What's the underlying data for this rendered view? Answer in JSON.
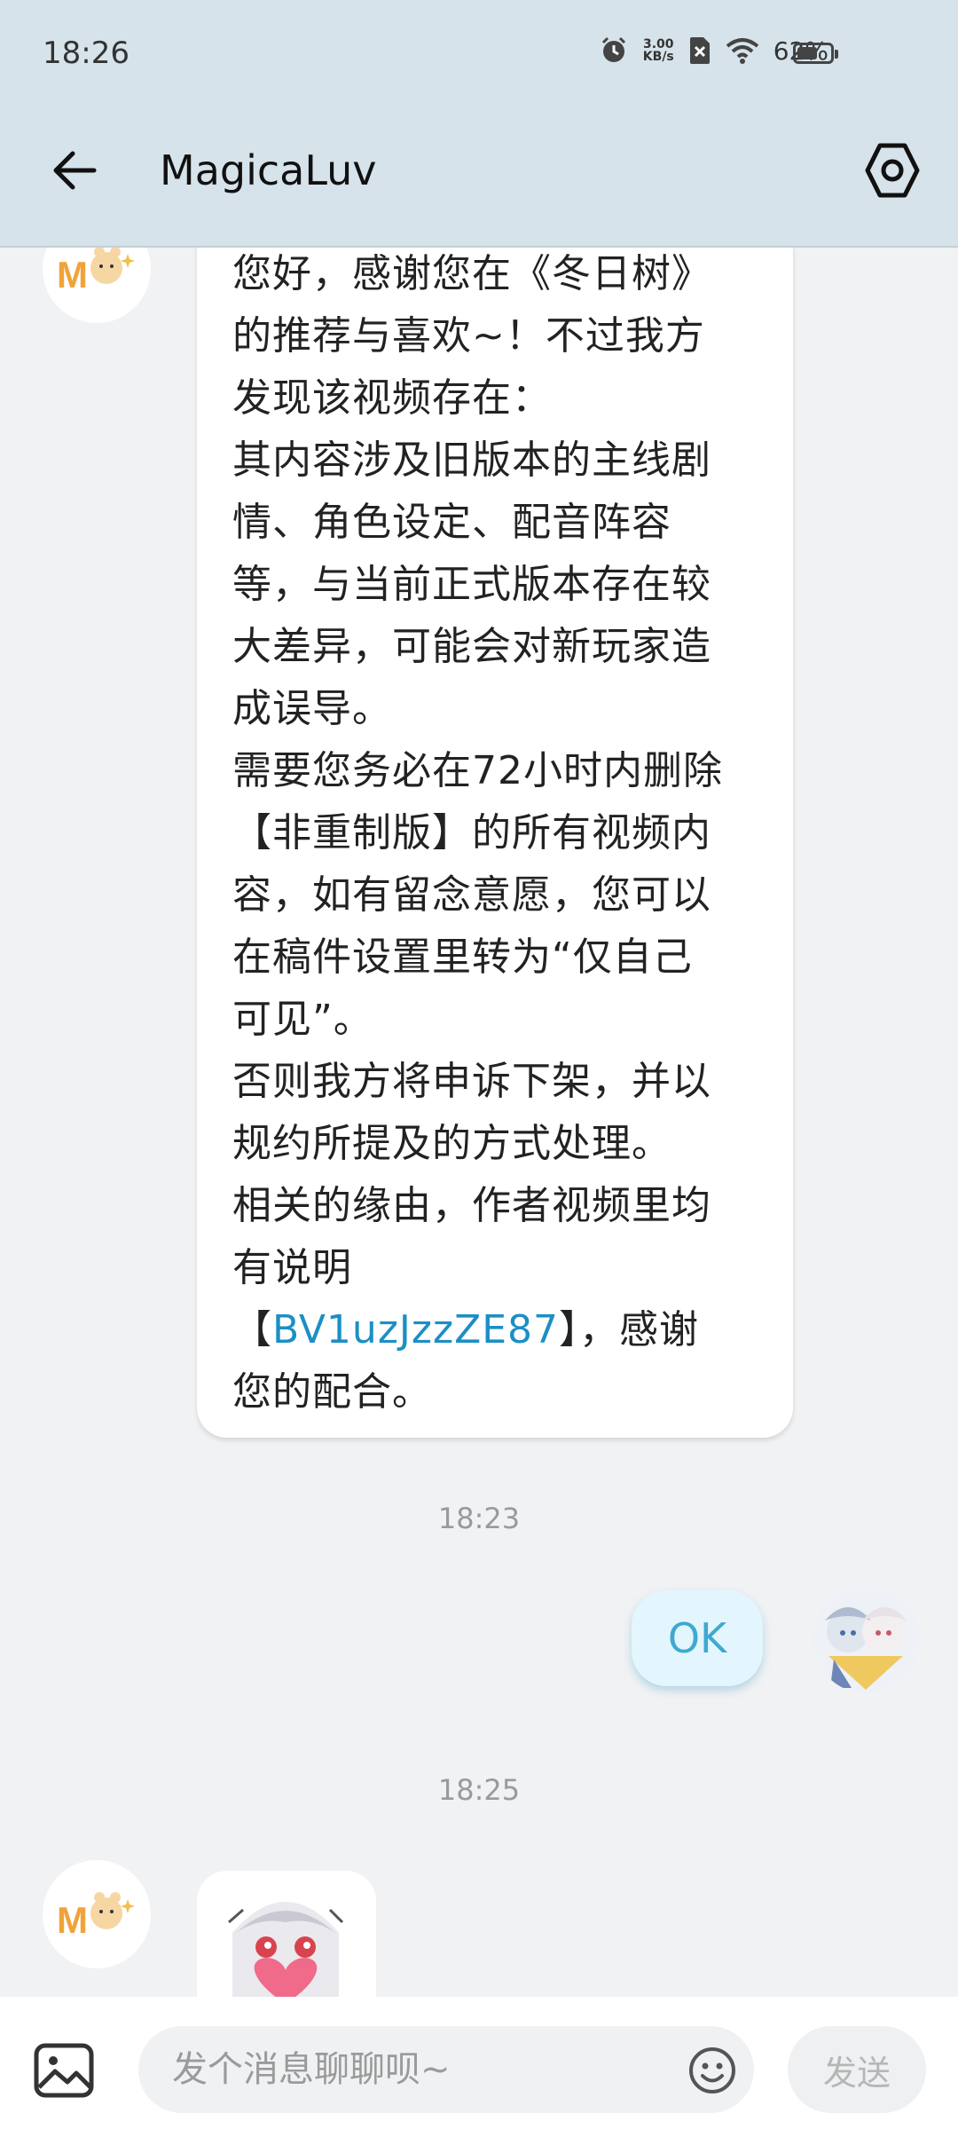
{
  "status_bar": {
    "time": "18:26",
    "net_speed_value": "3.00",
    "net_speed_unit": "KB/s",
    "battery": "62%",
    "battery_level": 0.62
  },
  "header": {
    "title": "MagicaLuv",
    "back_icon": "arrow-left-icon",
    "settings_icon": "settings-icon"
  },
  "messages": {
    "incoming_1": {
      "avatar_icon": "magicaluv-avatar-icon",
      "lines": [
        "您好，感谢您在《冬日树》",
        "的推荐与喜欢~！不过我方",
        "发现该视频存在：",
        "其内容涉及旧版本的主线剧",
        "情、角色设定、配音阵容",
        "等，与当前正式版本存在较",
        "大差异，可能会对新玩家造",
        "成误导。",
        "需要您务必在72小时内删除",
        "【非重制版】的所有视频内",
        "容，如有留念意愿，您可以",
        "在稿件设置里转为“仅自己",
        "可见”。",
        "否则我方将申诉下架，并以",
        "规约所提及的方式处理。",
        "相关的缘由，作者视频里均",
        "有说明"
      ],
      "link_prefix": "【",
      "link_text": "BV1uzJzzZE87",
      "link_suffix": "】，感谢",
      "last_line": "您的配合。"
    },
    "timestamp_1": "18:23",
    "outgoing_1": {
      "text": "OK",
      "avatar_icon": "user-avatar-icon"
    },
    "timestamp_2": "18:25",
    "incoming_2": {
      "avatar_icon": "magicaluv-avatar-icon",
      "sticker_icon": "anime-girl-heart-sticker-icon"
    }
  },
  "input_bar": {
    "image_icon": "image-icon",
    "placeholder": "发个消息聊聊呗~",
    "emoji_icon": "emoji-icon",
    "send_label": "发送"
  },
  "colors": {
    "header_bg": "#d6e3ea",
    "page_bg": "#f1f2f4",
    "link": "#1b8fc5",
    "ok_bubble": "#e4f6fd",
    "ok_text": "#3fa9d0"
  }
}
